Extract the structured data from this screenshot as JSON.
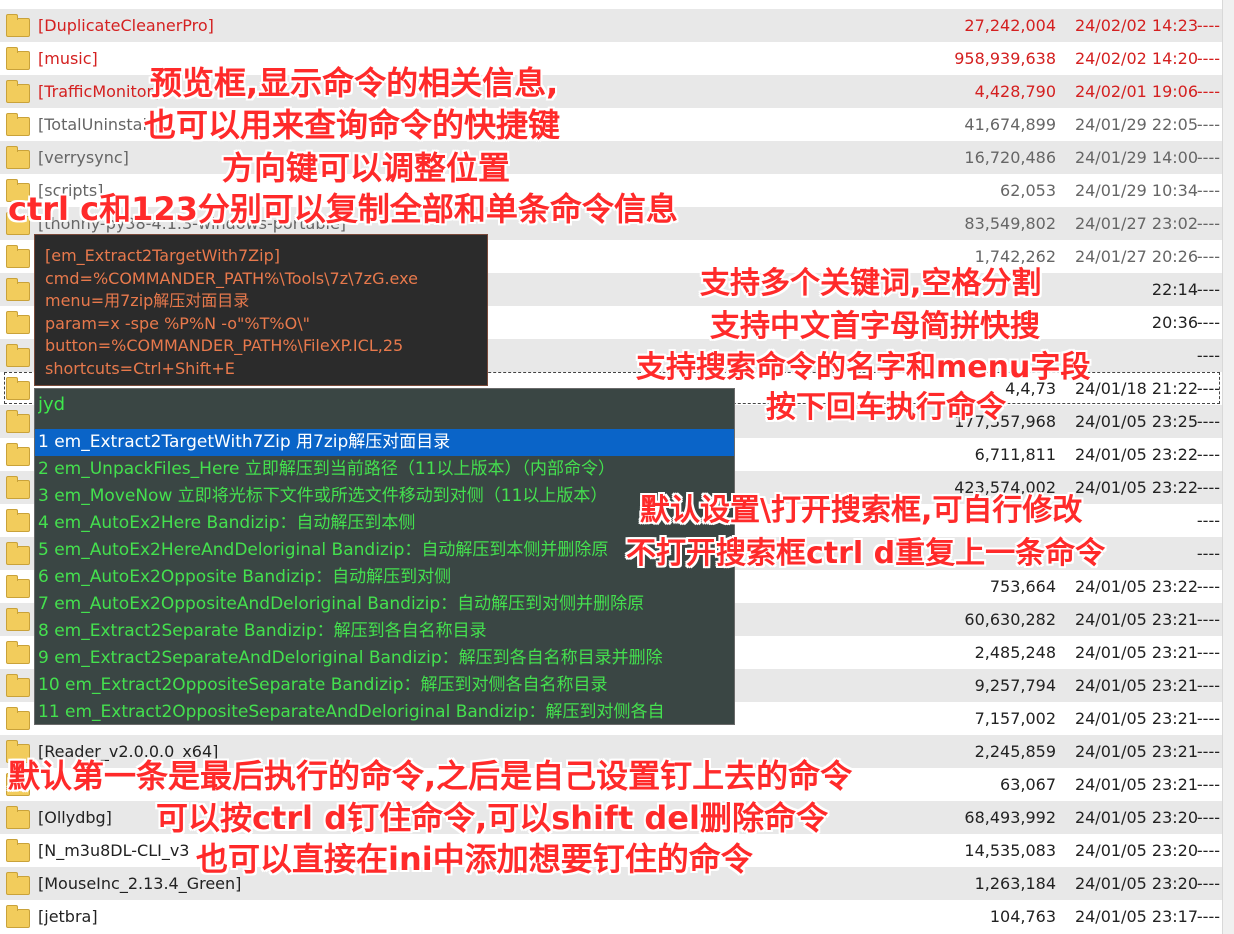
{
  "file_rows": [
    {
      "name": "[DuplicateCleanerPro]",
      "size": "27,242,004",
      "date": "24/02/02 14:23",
      "attr": "----",
      "style": "red",
      "bg": "alt"
    },
    {
      "name": "[music]",
      "size": "958,939,638",
      "date": "24/02/02 14:20",
      "attr": "----",
      "style": "red",
      "bg": "white"
    },
    {
      "name": "[TrafficMonitor]",
      "size": "4,428,790",
      "date": "24/02/01 19:06",
      "attr": "----",
      "style": "red",
      "bg": "alt"
    },
    {
      "name": "[TotalUninstall]",
      "size": "41,674,899",
      "date": "24/01/29 22:05",
      "attr": "----",
      "style": "gray",
      "bg": "white"
    },
    {
      "name": "[verrysync]",
      "size": "16,720,486",
      "date": "24/01/29 14:00",
      "attr": "----",
      "style": "gray",
      "bg": "alt"
    },
    {
      "name": "[scripts]",
      "size": "62,053",
      "date": "24/01/29 10:34",
      "attr": "----",
      "style": "gray",
      "bg": "white"
    },
    {
      "name": "[thonny-py38-4.1.3-windows-portable]",
      "size": "83,549,802",
      "date": "24/01/27 23:02",
      "attr": "----",
      "style": "gray",
      "bg": "alt"
    },
    {
      "name": "",
      "size": "1,742,262",
      "date": "24/01/27 20:26",
      "attr": "----",
      "style": "gray",
      "bg": "white"
    },
    {
      "name": "",
      "size": "",
      "date": "22:14",
      "attr": "----",
      "style": "dark",
      "bg": "alt"
    },
    {
      "name": "",
      "size": "",
      "date": "20:36",
      "attr": "----",
      "style": "dark",
      "bg": "white"
    },
    {
      "name": "",
      "size": "",
      "date": "",
      "attr": "----",
      "style": "dark",
      "bg": "alt"
    },
    {
      "name": "",
      "size": "4,4,73",
      "date": "24/01/18 21:22",
      "attr": "----",
      "style": "dark",
      "bg": "white"
    },
    {
      "name": "",
      "size": "177,357,968",
      "date": "24/01/05 23:25",
      "attr": "----",
      "style": "dark",
      "bg": "alt"
    },
    {
      "name": "",
      "size": "6,711,811",
      "date": "24/01/05 23:22",
      "attr": "----",
      "style": "dark",
      "bg": "white"
    },
    {
      "name": "",
      "size": "423,574,002",
      "date": "24/01/05 23:22",
      "attr": "----",
      "style": "dark",
      "bg": "alt"
    },
    {
      "name": "",
      "size": "",
      "date": "",
      "attr": "----",
      "style": "dark",
      "bg": "white"
    },
    {
      "name": "",
      "size": "",
      "date": "",
      "attr": "----",
      "style": "dark",
      "bg": "alt"
    },
    {
      "name": "",
      "size": "753,664",
      "date": "24/01/05 23:22",
      "attr": "----",
      "style": "dark",
      "bg": "white"
    },
    {
      "name": "",
      "size": "60,630,282",
      "date": "24/01/05 23:21",
      "attr": "----",
      "style": "dark",
      "bg": "alt"
    },
    {
      "name": "",
      "size": "2,485,248",
      "date": "24/01/05 23:21",
      "attr": "----",
      "style": "dark",
      "bg": "white"
    },
    {
      "name": "",
      "size": "9,257,794",
      "date": "24/01/05 23:21",
      "attr": "----",
      "style": "dark",
      "bg": "alt"
    },
    {
      "name": "",
      "size": "7,157,002",
      "date": "24/01/05 23:21",
      "attr": "----",
      "style": "dark",
      "bg": "white"
    },
    {
      "name": "[Reader_v2.0.0.0_x64]",
      "size": "2,245,859",
      "date": "24/01/05 23:21",
      "attr": "----",
      "style": "dark",
      "bg": "alt"
    },
    {
      "name": "",
      "size": "63,067",
      "date": "24/01/05 23:21",
      "attr": "----",
      "style": "dark",
      "bg": "white"
    },
    {
      "name": "[Ollydbg]",
      "size": "68,493,992",
      "date": "24/01/05 23:20",
      "attr": "----",
      "style": "dark",
      "bg": "alt"
    },
    {
      "name": "[N_m3u8DL-CLI_v3",
      "size": "14,535,083",
      "date": "24/01/05 23:20",
      "attr": "----",
      "style": "dark",
      "bg": "white"
    },
    {
      "name": "[MouseInc_2.13.4_Green]",
      "size": "1,263,184",
      "date": "24/01/05 23:20",
      "attr": "----",
      "style": "dark",
      "bg": "alt"
    },
    {
      "name": "[jetbra]",
      "size": "104,763",
      "date": "24/01/05 23:17",
      "attr": "----",
      "style": "dark",
      "bg": "white"
    }
  ],
  "preview": {
    "lines": [
      "[em_Extract2TargetWith7Zip]",
      "cmd=%COMMANDER_PATH%\\Tools\\7z\\7zG.exe",
      "menu=用7zip解压对面目录",
      "param=x -spe %P%N -o\"%T%O\\\"",
      "button=%COMMANDER_PATH%\\FileXP.ICL,25",
      "shortcuts=Ctrl+Shift+E"
    ]
  },
  "search": {
    "query": "jyd",
    "results": [
      "1 em_Extract2TargetWith7Zip 用7zip解压对面目录",
      "2 em_UnpackFiles_Here 立即解压到当前路径（11以上版本）（内部命令）",
      "3 em_MoveNow 立即将光标下文件或所选文件移动到对侧（11以上版本）",
      "4 em_AutoEx2Here Bandizip：自动解压到本侧",
      "5 em_AutoEx2HereAndDeloriginal Bandizip：自动解压到本侧并删除原",
      "6 em_AutoEx2Opposite Bandizip：自动解压到对侧",
      "7 em_AutoEx2OppositeAndDeloriginal Bandizip：自动解压到对侧并删除原",
      "8 em_Extract2Separate Bandizip：解压到各自名称目录",
      "9 em_Extract2SeparateAndDeloriginal Bandizip：解压到各自名称目录并删除",
      "10 em_Extract2OppositeSeparate Bandizip：解压到对侧各自名称目录",
      "11 em_Extract2OppositeSeparateAndDeloriginal Bandizip：解压到对侧各自"
    ],
    "selected_index": 0
  },
  "annotations": {
    "a1": "预览框,显示命令的相关信息,",
    "a2": "也可以用来查询命令的快捷键",
    "a3": "方向键可以调整位置",
    "a4": "ctrl c和123分别可以复制全部和单条命令信息",
    "b1": "支持多个关键词,空格分割",
    "b2": "支持中文首字母简拼快搜",
    "b3": "支持搜索命令的名字和menu字段",
    "b4": "按下回车执行命令",
    "c1": "默认设置\\打开搜索框,可自行修改",
    "c2": "不打开搜索框ctrl d重复上一条命令",
    "d1": "默认第一条是最后执行的命令,之后是自己设置钉上去的命令",
    "d2": "可以按ctrl d钉住命令,可以shift del删除命令",
    "d3": "也可以直接在ini中添加想要钉住的命令"
  },
  "colors": {
    "annotation": "#ff2a2a",
    "command_text": "#44e04e",
    "selection": "#0a64c8",
    "preview_text": "#e8794c"
  }
}
